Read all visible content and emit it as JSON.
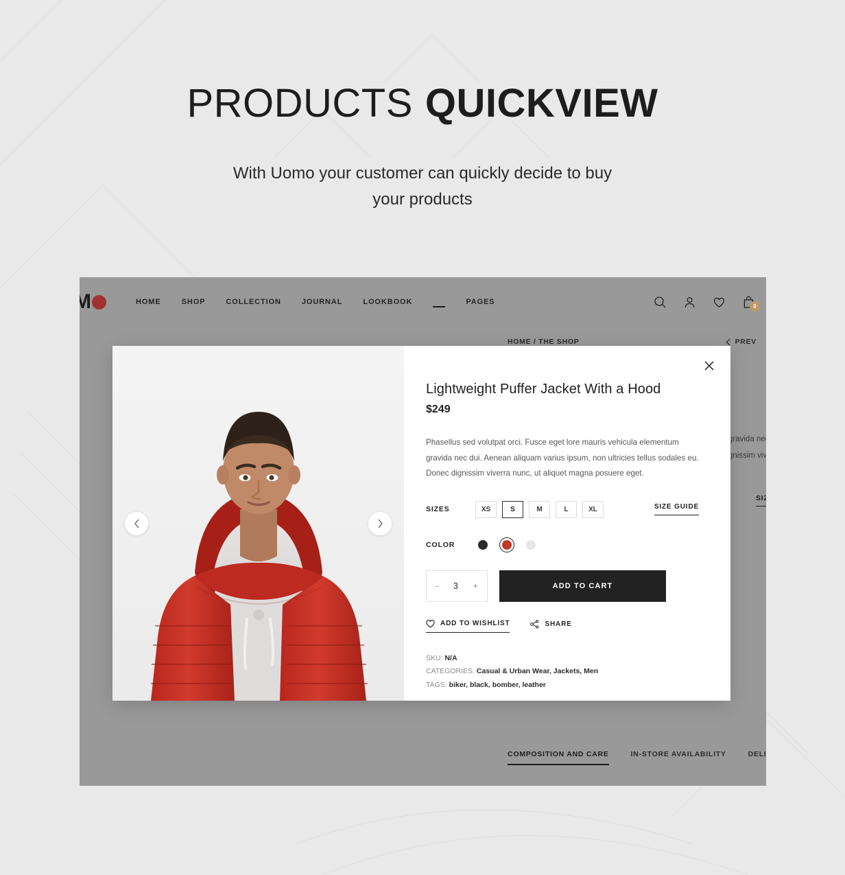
{
  "promo": {
    "title_light": "PRODUCTS",
    "title_bold": "QUICKVIEW",
    "subtitle_line1": "With Uomo your customer can quickly decide to buy",
    "subtitle_line2": "your products"
  },
  "site_header": {
    "logo_text": "M",
    "nav": [
      {
        "label": "HOME"
      },
      {
        "label": "SHOP"
      },
      {
        "label": "COLLECTION"
      },
      {
        "label": "JOURNAL"
      },
      {
        "label": "LOOKBOOK"
      },
      {
        "label": "PAGES"
      }
    ],
    "icons": [
      {
        "name": "search-icon"
      },
      {
        "name": "account-icon"
      },
      {
        "name": "wishlist-icon"
      },
      {
        "name": "cart-icon"
      }
    ],
    "cart_count": "0"
  },
  "breadcrumb": {
    "trail": "HOME / THE SHOP",
    "prev_label": "PREV"
  },
  "background_page": {
    "desc_fragment_1": "gravida nec",
    "desc_fragment_2": "gnissim viverra",
    "size_guide_fragment": "SIZ",
    "tabs": [
      {
        "label": "COMPOSITION AND CARE",
        "active": true
      },
      {
        "label": "IN-STORE AVAILABILITY",
        "active": false
      },
      {
        "label": "DELIVERY AND RETURNS",
        "active": false
      }
    ]
  },
  "quickview": {
    "close_label": "✕",
    "gallery": {
      "prev_label": "‹",
      "next_label": "›",
      "image_alt": "model-wearing-red-puffer-jacket"
    },
    "product": {
      "title": "Lightweight Puffer Jacket With a Hood",
      "price": "$249",
      "description": "Phasellus sed volutpat orci. Fusce eget lore mauris vehicula elementum gravida nec dui. Aenean aliquam varius ipsum, non ultricies tellus sodales eu. Donec dignissim viverra nunc, ut aliquet magna posuere eget."
    },
    "sizes": {
      "label": "SIZES",
      "options": [
        "XS",
        "S",
        "M",
        "L",
        "XL"
      ],
      "selected": "S",
      "guide_label": "SIZE GUIDE"
    },
    "colors": {
      "label": "COLOR",
      "options": [
        {
          "name": "black",
          "hex": "#2b2b2b",
          "selected": false
        },
        {
          "name": "red",
          "hex": "#c0392b",
          "selected": true
        },
        {
          "name": "light-grey",
          "hex": "#e6e6e6",
          "selected": false
        }
      ]
    },
    "quantity": {
      "decrement": "-",
      "value": "3",
      "increment": "+"
    },
    "add_to_cart_label": "ADD TO CART",
    "wishlist_label": "ADD TO WISHLIST",
    "share_label": "SHARE",
    "meta": {
      "sku_label": "SKU:",
      "sku_value": "N/A",
      "categories_label": "CATEGORIES:",
      "categories_value": "Casual & Urban Wear, Jackets, Men",
      "tags_label": "TAGS:",
      "tags_value": "biker, black, bomber, leather"
    }
  },
  "colors": {
    "page_bg": "#e9e9e9",
    "accent_red": "#a23131",
    "dark": "#222222",
    "dim_overlay": "#999999"
  }
}
